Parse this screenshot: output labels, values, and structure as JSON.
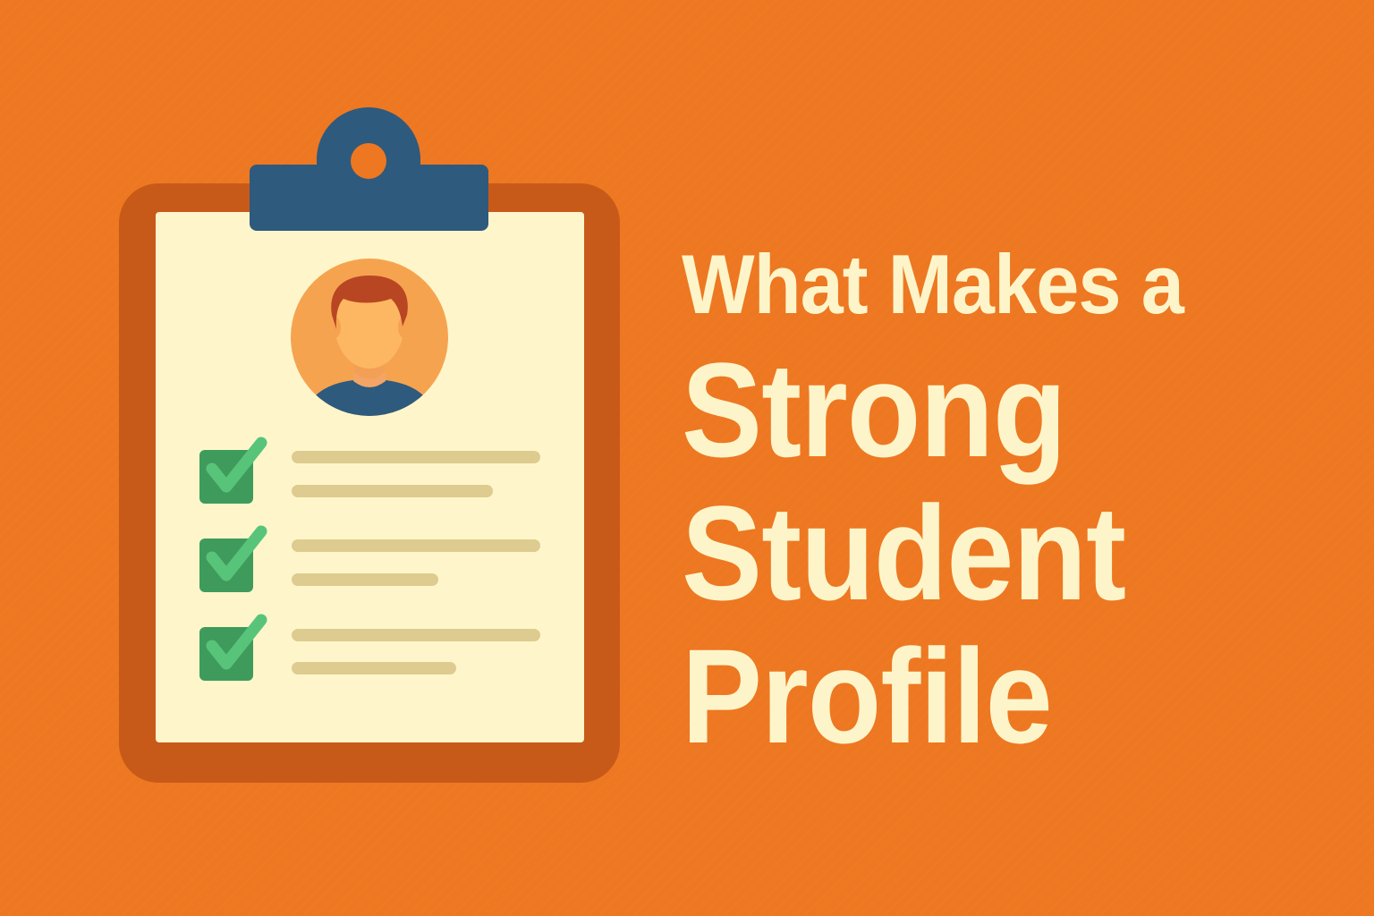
{
  "headline": {
    "line1": "What Makes a",
    "line2": "Strong",
    "line3": "Student",
    "line4": "Profile"
  },
  "colors": {
    "background": "#ee7721",
    "clipboard_frame": "#c85a19",
    "paper": "#fef6ca",
    "clip": "#2e5a7e",
    "checkbox": "#3e9b5c",
    "checkmark": "#57c47a",
    "text_line": "#decb8f",
    "avatar_bg": "#f6a350",
    "headline_text": "#fdf5c9"
  },
  "icons": {
    "clipboard": "clipboard-icon",
    "avatar": "student-avatar-icon",
    "check": "checked-checkbox-icon"
  },
  "checklist": {
    "items": [
      {
        "checked": true
      },
      {
        "checked": true
      },
      {
        "checked": true
      }
    ]
  }
}
